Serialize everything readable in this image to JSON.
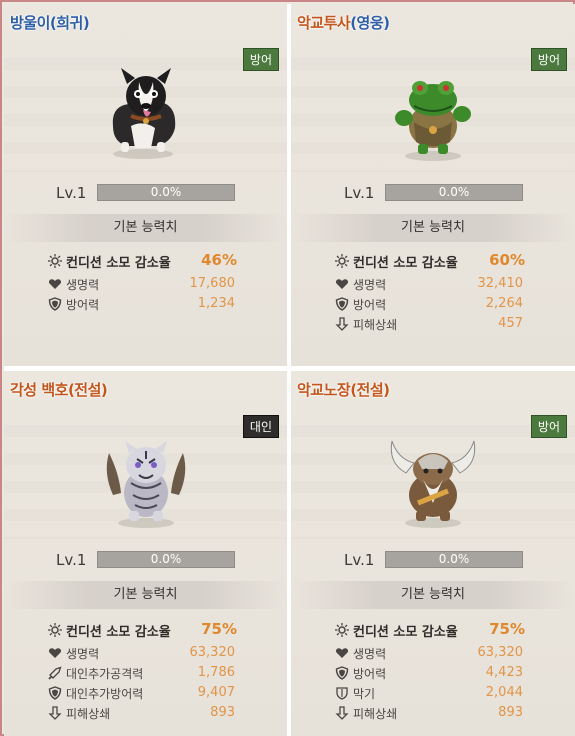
{
  "cards": [
    {
      "name": "방울이",
      "grade": "(희귀)",
      "badge": "방어",
      "level": "Lv.1",
      "progress_text": "0.0%",
      "progress": 0,
      "section": "기본 능력치",
      "stats": [
        {
          "label": "컨디션 소모 감소율",
          "value": "46%",
          "icon": "sun-icon"
        },
        {
          "label": "생명력",
          "value": "17,680",
          "icon": "heart-icon"
        },
        {
          "label": "방어력",
          "value": "1,234",
          "icon": "shield-icon"
        }
      ]
    },
    {
      "name": "악교투사",
      "grade": "(영웅)",
      "badge": "방어",
      "level": "Lv.1",
      "progress_text": "0.0%",
      "progress": 0,
      "section": "기본 능력치",
      "stats": [
        {
          "label": "컨디션 소모 감소율",
          "value": "60%",
          "icon": "sun-icon"
        },
        {
          "label": "생명력",
          "value": "32,410",
          "icon": "heart-icon"
        },
        {
          "label": "방어력",
          "value": "2,264",
          "icon": "shield-icon"
        },
        {
          "label": "피해상쇄",
          "value": "457",
          "icon": "arrow-down-icon"
        }
      ]
    },
    {
      "name": "각성 백호",
      "grade": "(전설)",
      "badge": "대인",
      "level": "Lv.1",
      "progress_text": "0.0%",
      "progress": 0,
      "section": "기본 능력치",
      "stats": [
        {
          "label": "컨디션 소모 감소율",
          "value": "75%",
          "icon": "sun-icon"
        },
        {
          "label": "생명력",
          "value": "63,320",
          "icon": "heart-icon"
        },
        {
          "label": "대인추가공격력",
          "value": "1,786",
          "icon": "sword-icon"
        },
        {
          "label": "대인추가방어력",
          "value": "9,407",
          "icon": "shield-icon"
        },
        {
          "label": "피해상쇄",
          "value": "893",
          "icon": "arrow-down-icon"
        }
      ]
    },
    {
      "name": "악교노장",
      "grade": "(전설)",
      "badge": "방어",
      "level": "Lv.1",
      "progress_text": "0.0%",
      "progress": 0,
      "section": "기본 능력치",
      "stats": [
        {
          "label": "컨디션 소모 감소율",
          "value": "75%",
          "icon": "sun-icon"
        },
        {
          "label": "생명력",
          "value": "63,320",
          "icon": "heart-icon"
        },
        {
          "label": "방어력",
          "value": "4,423",
          "icon": "shield-icon"
        },
        {
          "label": "막기",
          "value": "2,044",
          "icon": "block-shield-icon"
        },
        {
          "label": "피해상쇄",
          "value": "893",
          "icon": "arrow-down-icon"
        }
      ]
    }
  ],
  "colors": {
    "badge_defense": "#4c7a3e",
    "badge_pvp": "#2f2d2b",
    "value_orange": "#e29548",
    "name_blue": "#2e5fa6",
    "name_orange": "#c3561c"
  }
}
